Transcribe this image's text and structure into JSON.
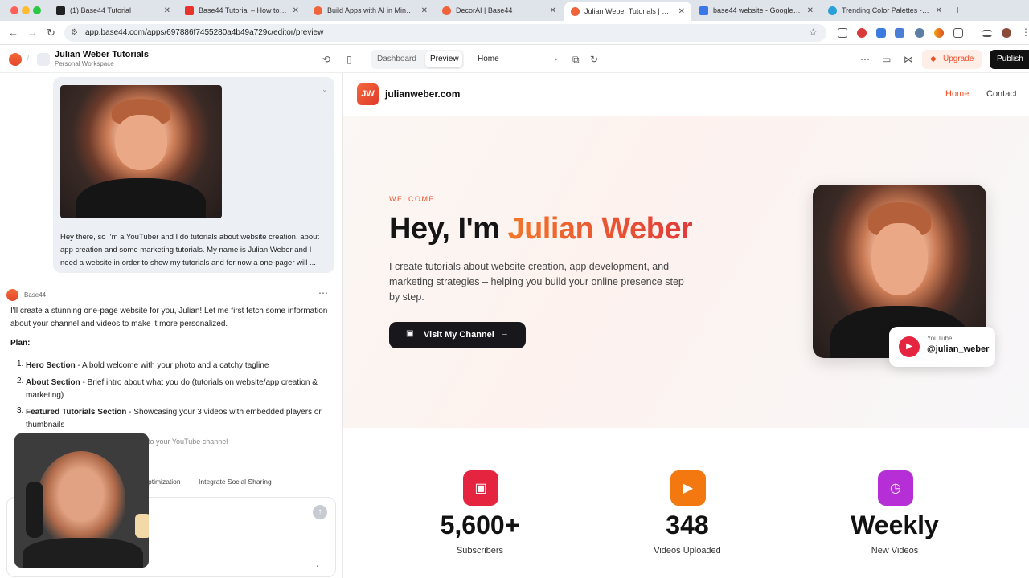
{
  "browser": {
    "tabs": [
      {
        "label": "(1) Base44 Tutorial",
        "favicon_color": "#222222"
      },
      {
        "label": "Base44 Tutorial – How to buil",
        "favicon_color": "#e8332a"
      },
      {
        "label": "Build Apps with AI in Minutes",
        "favicon_color": "#f0643c"
      },
      {
        "label": "DecorAI | Base44",
        "favicon_color": "#f0643c"
      },
      {
        "label": "Julian Weber Tutorials | Base",
        "favicon_color": "#f0643c",
        "active": true
      },
      {
        "label": "base44 website - Google Doc",
        "favicon_color": "#3b78e7"
      },
      {
        "label": "Trending Color Palettes - Coo",
        "favicon_color": "#2b9fd8"
      }
    ],
    "url": "app.base44.com/apps/697886f7455280a4b49a729c/editor/preview"
  },
  "app_toolbar": {
    "project_title": "Julian Weber Tutorials",
    "workspace": "Personal Workspace",
    "dashboard_label": "Dashboard",
    "preview_label": "Preview",
    "page_select": "Home",
    "upgrade_label": "Upgrade",
    "publish_label": "Publish"
  },
  "chat": {
    "user_message": "Hey there, so I'm a YouTuber and I do tutorials about website creation, about app creation and some marketing tutorials. My name is Julian Weber and I need a website in order to show my tutorials and for now a one-pager will ...",
    "assistant_name": "Base44",
    "assistant_intro": "I'll create a stunning one-page website for you, Julian! Let me first fetch some information about your channel and videos to make it more personalized.",
    "plan_heading": "Plan:",
    "plan_items": [
      {
        "num": "1.",
        "title": "Hero Section",
        "text": " - A bold welcome with your photo and a catchy tagline"
      },
      {
        "num": "2.",
        "title": "About Section",
        "text": " - Brief intro about what you do (tutorials on website/app creation & marketing)"
      },
      {
        "num": "3.",
        "title": "Featured Tutorials Section",
        "text": " - Showcasing your 3 videos with embedded players or thumbnails"
      }
    ],
    "partial_line": "to your YouTube channel",
    "chip_1": "ptimization",
    "chip_2": "Integrate Social Sharing"
  },
  "site": {
    "logo_initials": "JW",
    "domain": "julianweber.com",
    "nav_home": "Home",
    "nav_contact": "Contact",
    "eyebrow": "WELCOME",
    "headline_prefix": "Hey, I'm ",
    "headline_name": "Julian Weber",
    "description": "I create tutorials about website creation, app development, and marketing strategies – helping you build your online presence step by step.",
    "cta_label": "Visit My Channel",
    "badge_platform": "YouTube",
    "badge_handle": "@julian_weber",
    "stats": [
      {
        "value": "5,600+",
        "label": "Subscribers",
        "color": "#e5253f"
      },
      {
        "value": "348",
        "label": "Videos Uploaded",
        "color": "#f2780f"
      },
      {
        "value": "Weekly",
        "label": "New Videos",
        "color": "#b62fd6"
      }
    ]
  },
  "colors": {
    "accent": "#ef4f2b",
    "dark_button": "#17171c"
  }
}
